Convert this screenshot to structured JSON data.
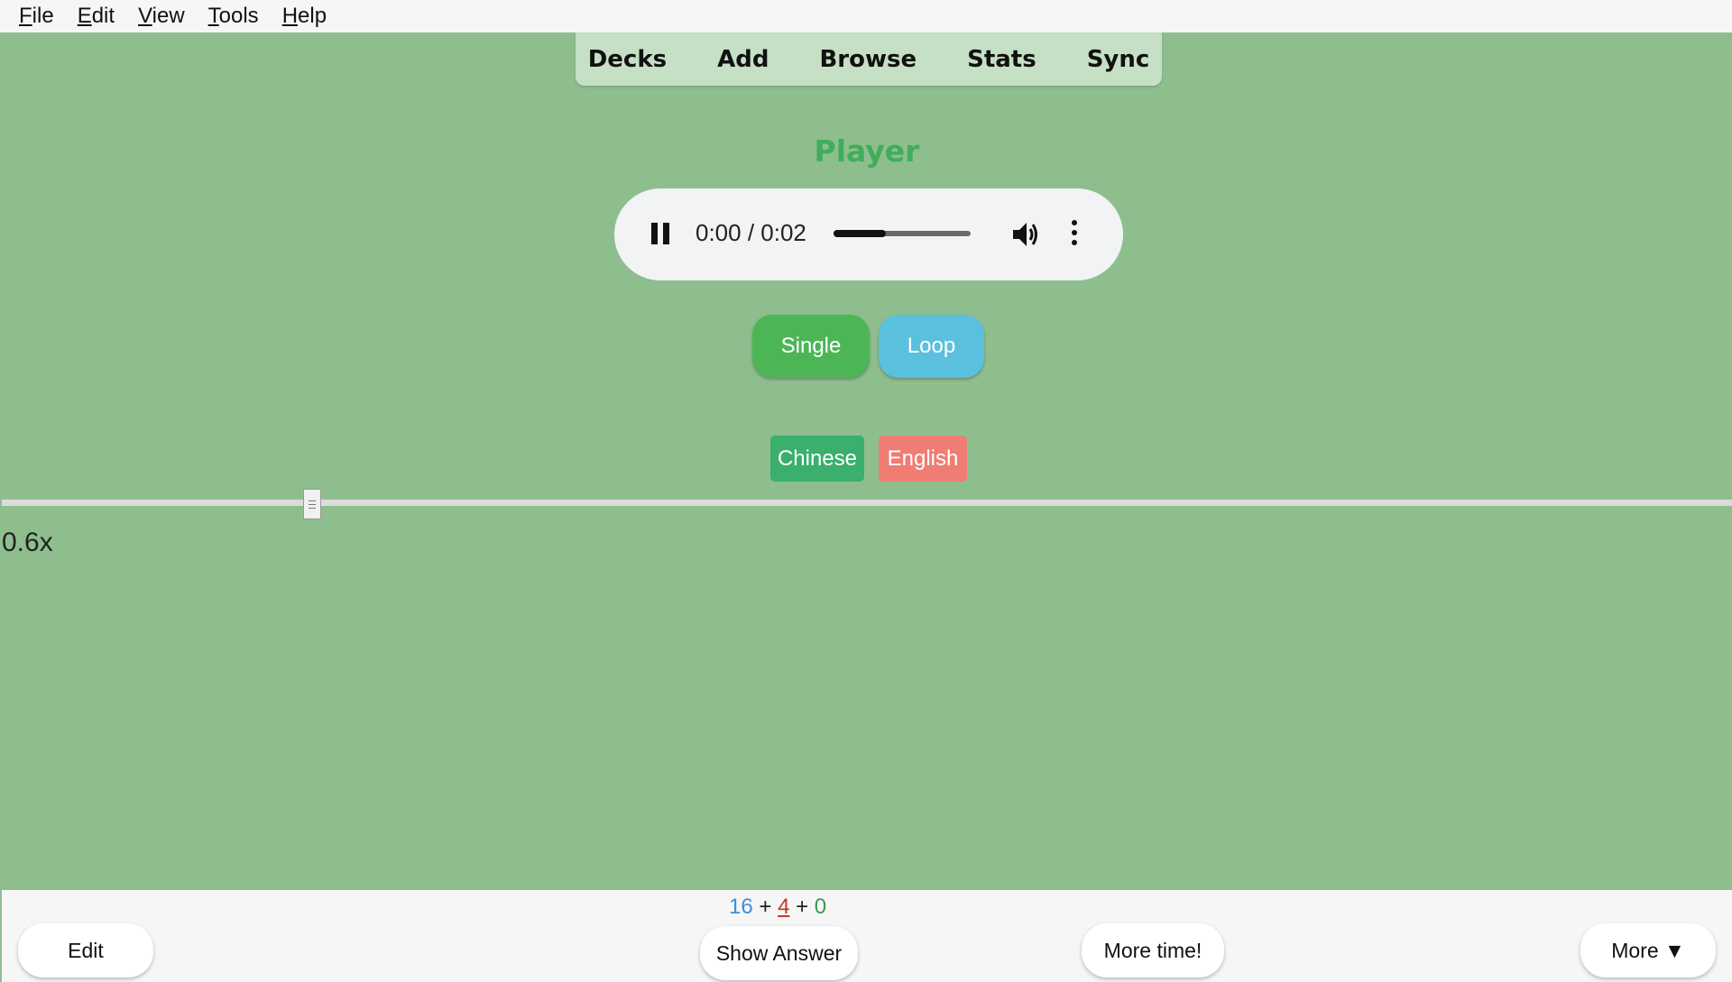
{
  "menu": {
    "items": [
      {
        "label_u": "F",
        "label_rest": "ile"
      },
      {
        "label_u": "E",
        "label_rest": "dit"
      },
      {
        "label_u": "V",
        "label_rest": "iew"
      },
      {
        "label_u": "T",
        "label_rest": "ools"
      },
      {
        "label_u": "H",
        "label_rest": "elp"
      }
    ]
  },
  "nav": {
    "decks": "Decks",
    "add": "Add",
    "browse": "Browse",
    "stats": "Stats",
    "sync": "Sync"
  },
  "card": {
    "title": "Player",
    "audio": {
      "time": "0:00 / 0:02",
      "progress": 0.38
    },
    "mode_buttons": {
      "single": "Single",
      "loop": "Loop"
    },
    "tags": {
      "chinese": "Chinese",
      "english": "English"
    },
    "speed": {
      "label": "0.6x",
      "value": 0.6
    }
  },
  "counts": {
    "new": "16",
    "sep1": "+",
    "learn": "4",
    "sep2": "+",
    "review": "0"
  },
  "bottom": {
    "edit": "Edit",
    "show_answer": "Show Answer",
    "more_time": "More time!",
    "more": "More ▼"
  },
  "colors": {
    "background": "#8fbe8e",
    "title": "#3fae5b",
    "single": "#4cb657",
    "loop": "#5bc0de",
    "chinese": "#3aaf6e",
    "english": "#ef7d73"
  }
}
